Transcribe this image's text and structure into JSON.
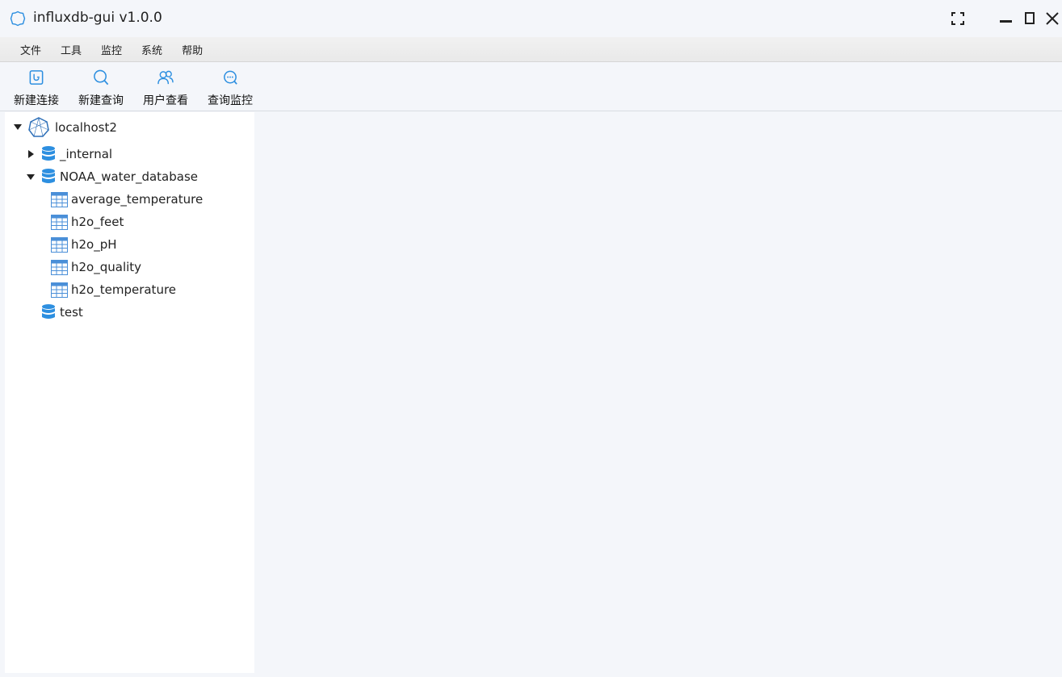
{
  "window": {
    "title": "influxdb-gui v1.0.0",
    "accent": "#2d8fe0"
  },
  "menu": {
    "items": [
      "文件",
      "工具",
      "监控",
      "系统",
      "帮助"
    ]
  },
  "toolbar": {
    "new_connection": "新建连接",
    "new_query": "新建查询",
    "user_view": "用户查看",
    "query_monitor": "查询监控"
  },
  "tree": {
    "connection": {
      "label": "localhost2",
      "expanded": true
    },
    "databases": [
      {
        "label": "_internal",
        "expanded": false
      },
      {
        "label": "NOAA_water_database",
        "expanded": true,
        "measurements": [
          "average_temperature",
          "h2o_feet",
          "h2o_pH",
          "h2o_quality",
          "h2o_temperature"
        ]
      },
      {
        "label": "test",
        "expanded": false
      }
    ]
  }
}
